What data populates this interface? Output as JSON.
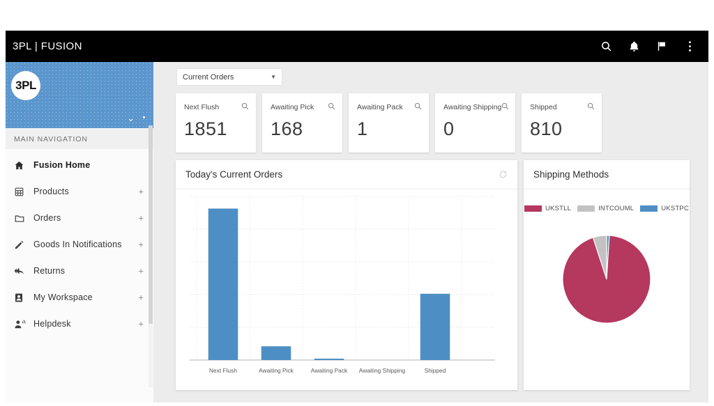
{
  "topbar": {
    "brand": "3PL | FUSION",
    "icons": [
      {
        "name": "search-icon",
        "label": "Search"
      },
      {
        "name": "bell-icon",
        "label": "Notifications"
      },
      {
        "name": "flag-icon",
        "label": "Flags"
      },
      {
        "name": "more-vertical-icon",
        "label": "More options"
      }
    ]
  },
  "sidebar": {
    "logo_text": "3PL",
    "nav_title": "MAIN NAVIGATION",
    "items": [
      {
        "label": "Fusion Home",
        "icon": "home-icon",
        "expandable": false,
        "active": true
      },
      {
        "label": "Products",
        "icon": "products-icon",
        "expandable": true,
        "active": false
      },
      {
        "label": "Orders",
        "icon": "folder-icon",
        "expandable": true,
        "active": false
      },
      {
        "label": "Goods In Notifications",
        "icon": "pencil-icon",
        "expandable": true,
        "active": false
      },
      {
        "label": "Returns",
        "icon": "returns-arrow-icon",
        "expandable": true,
        "active": false
      },
      {
        "label": "My Workspace",
        "icon": "user-card-icon",
        "expandable": true,
        "active": false
      },
      {
        "label": "Helpdesk",
        "icon": "support-agent-icon",
        "expandable": true,
        "active": false
      }
    ],
    "expand_symbol": "+"
  },
  "main": {
    "filter": {
      "selected": "Current Orders",
      "caret": "▼"
    },
    "kpi_cards": [
      {
        "label": "Next Flush",
        "value": "1851"
      },
      {
        "label": "Awaiting Pick",
        "value": "168"
      },
      {
        "label": "Awaiting Pack",
        "value": "1"
      },
      {
        "label": "Awaiting Shipping",
        "value": "0"
      },
      {
        "label": "Shipped",
        "value": "810"
      }
    ],
    "orders_panel": {
      "title": "Today's Current Orders"
    },
    "shipping_panel": {
      "title": "Shipping Methods"
    }
  },
  "chart_data": [
    {
      "type": "bar",
      "title": "Today's Current Orders",
      "categories": [
        "Next Flush",
        "Awaiting Pick",
        "Awaiting Pack",
        "Awaiting Shipping",
        "Shipped"
      ],
      "values": [
        1851,
        168,
        1,
        0,
        810
      ],
      "xlabel": "",
      "ylabel": "",
      "ylim": [
        0,
        2000
      ],
      "grid": true,
      "legend": false,
      "bar_color": "#4d8fc4"
    },
    {
      "type": "pie",
      "title": "Shipping Methods",
      "labels": [
        "UKSTLL",
        "INTCOUML",
        "UKSTPC"
      ],
      "values": [
        94,
        5,
        1
      ],
      "colors": [
        "#b5385e",
        "#c2c2c2",
        "#4d8fc4"
      ],
      "legend": true,
      "legend_position": "top"
    }
  ]
}
